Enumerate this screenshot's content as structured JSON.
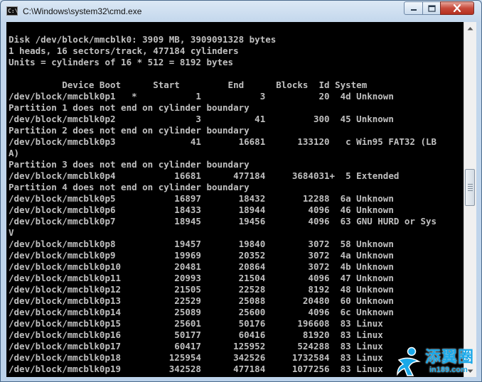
{
  "window": {
    "title": "C:\\Windows\\system32\\cmd.exe",
    "icon_text": "C:\\"
  },
  "console": {
    "lines": [
      "Disk /dev/block/mmcblk0: 3909 MB, 3909091328 bytes",
      "1 heads, 16 sectors/track, 477184 cylinders",
      "Units = cylinders of 16 * 512 = 8192 bytes",
      "",
      "          Device Boot      Start         End      Blocks  Id System",
      "/dev/block/mmcblk0p1   *           1           3          20  4d Unknown",
      "Partition 1 does not end on cylinder boundary",
      "/dev/block/mmcblk0p2               3          41         300  45 Unknown",
      "Partition 2 does not end on cylinder boundary",
      "/dev/block/mmcblk0p3              41       16681      133120   c Win95 FAT32 (LB",
      "A)",
      "Partition 3 does not end on cylinder boundary",
      "/dev/block/mmcblk0p4           16681      477184     3684031+  5 Extended",
      "Partition 4 does not end on cylinder boundary",
      "/dev/block/mmcblk0p5           16897       18432       12288  6a Unknown",
      "/dev/block/mmcblk0p6           18433       18944        4096  46 Unknown",
      "/dev/block/mmcblk0p7           18945       19456        4096  63 GNU HURD or Sys",
      "V",
      "/dev/block/mmcblk0p8           19457       19840        3072  58 Unknown",
      "/dev/block/mmcblk0p9           19969       20352        3072  4a Unknown",
      "/dev/block/mmcblk0p10          20481       20864        3072  4b Unknown",
      "/dev/block/mmcblk0p11          20993       21504        4096  47 Unknown",
      "/dev/block/mmcblk0p12          21505       22528        8192  48 Unknown",
      "/dev/block/mmcblk0p13          22529       25088       20480  60 Unknown",
      "/dev/block/mmcblk0p14          25089       25600        4096  6c Unknown",
      "/dev/block/mmcblk0p15          25601       50176      196608  83 Linux",
      "/dev/block/mmcblk0p16          50177       60416       81920  83 Linux",
      "/dev/block/mmcblk0p17          60417      125952      524288  83 Linux",
      "/dev/block/mmcblk0p18         125954      342526     1732584  83 Linux",
      "/dev/block/mmcblk0p19         342528      477184     1077256  83 Linux"
    ]
  },
  "watermark": {
    "text": "添翼圈",
    "url": "in189.com"
  },
  "colors": {
    "console_bg": "#000000",
    "console_fg": "#c0c0c0",
    "watermark": "#1aa8e8"
  },
  "scrollbar": {
    "position_fraction": 0.46
  }
}
